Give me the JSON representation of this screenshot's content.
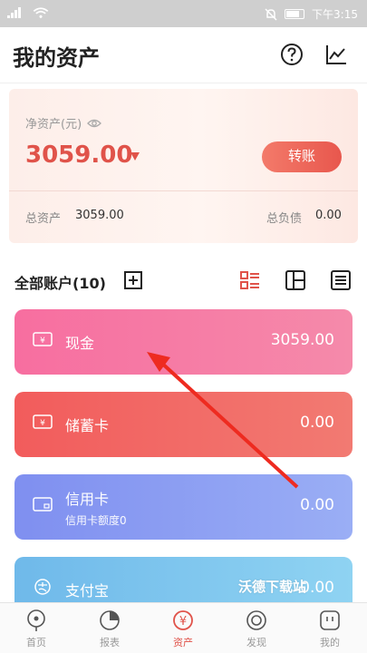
{
  "status_bar": {
    "time": "下午3:15"
  },
  "header": {
    "title": "我的资产",
    "help_icon": "question-circle-icon",
    "chart_icon": "trend-chart-icon"
  },
  "summary": {
    "net_label": "净资产(元)",
    "net_value": "3059.00",
    "transfer_label": "转账",
    "total_assets_label": "总资产",
    "total_assets_value": "3059.00",
    "total_debt_label": "总负债",
    "total_debt_value": "0.00"
  },
  "accounts": {
    "title": "全部账户(10)",
    "items": [
      {
        "name": "现金",
        "value": "3059.00",
        "sub": "",
        "icon": "cash-icon"
      },
      {
        "name": "储蓄卡",
        "value": "0.00",
        "sub": "",
        "icon": "debit-card-icon"
      },
      {
        "name": "信用卡",
        "value": "0.00",
        "sub": "信用卡额度0",
        "icon": "credit-card-icon"
      },
      {
        "name": "支付宝",
        "value": "0.00",
        "sub": "",
        "icon": "alipay-icon"
      }
    ]
  },
  "watermark": "沃德下载站",
  "tabs": [
    {
      "label": "首页",
      "icon": "home-icon"
    },
    {
      "label": "报表",
      "icon": "report-icon"
    },
    {
      "label": "资产",
      "icon": "asset-icon"
    },
    {
      "label": "发现",
      "icon": "discover-icon"
    },
    {
      "label": "我的",
      "icon": "profile-icon"
    }
  ],
  "colors": {
    "accent": "#e0534a",
    "card_cash": "#f56ba0",
    "card_debit": "#ef5f5f",
    "card_credit": "#8da0f2",
    "card_alipay": "#7cc5ec"
  }
}
